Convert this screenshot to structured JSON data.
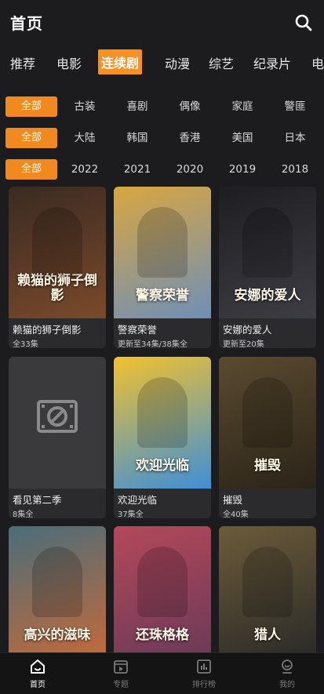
{
  "header": {
    "title": "首页",
    "search_icon": "search-icon"
  },
  "tabs": [
    {
      "label": "推荐",
      "active": false
    },
    {
      "label": "电影",
      "active": false
    },
    {
      "label": "连续剧",
      "active": true
    },
    {
      "label": "动漫",
      "active": false
    },
    {
      "label": "综艺",
      "active": false
    },
    {
      "label": "纪录片",
      "active": false
    },
    {
      "label": "电",
      "active": false
    }
  ],
  "filters": {
    "genre": {
      "selected": "全部",
      "options": [
        "古装",
        "喜剧",
        "偶像",
        "家庭",
        "警匪"
      ]
    },
    "region": {
      "selected": "全部",
      "options": [
        "大陆",
        "韩国",
        "香港",
        "美国",
        "日本"
      ]
    },
    "year": {
      "selected": "全部",
      "options": [
        "2022",
        "2021",
        "2020",
        "2019",
        "2018"
      ]
    }
  },
  "shows": [
    {
      "title": "赖猫的狮子倒影",
      "status": "全33集",
      "poster_text": "赖猫的狮子倒影",
      "colors": [
        "#3a2a22",
        "#7a4a2a"
      ]
    },
    {
      "title": "警察荣誉",
      "status": "更新至34集/38集全",
      "poster_text": "警察荣誉",
      "colors": [
        "#d9a640",
        "#6f8fb8"
      ]
    },
    {
      "title": "安娜的爱人",
      "status": "更新至20集",
      "poster_text": "安娜的爱人",
      "colors": [
        "#1e1e22",
        "#3d3d44"
      ]
    },
    {
      "title": "看见第二季",
      "status": "8集全",
      "poster_text": "",
      "colors": [
        "#3a3a3c",
        "#3a3a3c"
      ]
    },
    {
      "title": "欢迎光临",
      "status": "37集全",
      "poster_text": "欢迎光临",
      "colors": [
        "#f2c12e",
        "#3e8fd8"
      ]
    },
    {
      "title": "摧毁",
      "status": "全40集",
      "poster_text": "摧毁",
      "colors": [
        "#5a4a30",
        "#2b2418"
      ]
    },
    {
      "title": "",
      "status": "",
      "poster_text": "高兴的滋味",
      "colors": [
        "#4a6d7a",
        "#c46a3a"
      ]
    },
    {
      "title": "",
      "status": "",
      "poster_text": "还珠格格",
      "colors": [
        "#b5485a",
        "#6a3a58"
      ]
    },
    {
      "title": "",
      "status": "",
      "poster_text": "猎人",
      "colors": [
        "#6c5b3a",
        "#2a2a28"
      ]
    }
  ],
  "bottom_nav": [
    {
      "label": "首页",
      "icon": "home-icon",
      "active": true
    },
    {
      "label": "专题",
      "icon": "topic-icon",
      "active": false
    },
    {
      "label": "排行榜",
      "icon": "chart-icon",
      "active": false
    },
    {
      "label": "我的",
      "icon": "user-icon",
      "active": false
    }
  ],
  "colors": {
    "accent": "#f59222",
    "background": "#1c1c1e",
    "card": "#2b2b2d"
  }
}
